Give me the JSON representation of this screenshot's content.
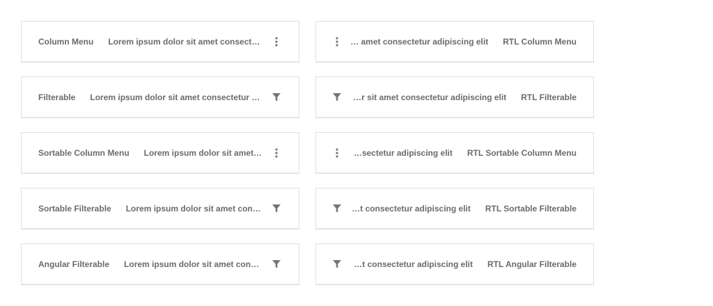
{
  "rows": [
    {
      "title": "Column Menu",
      "lorem_ltr": "Lorem ipsum dolor sit amet consectetur adipiscing elit",
      "rtl_title": "RTL Column Menu",
      "lorem_rtl": "…r sit amet consectetur adipiscing elit",
      "icon": "more-vert-icon"
    },
    {
      "title": "Filterable",
      "lorem_ltr": "Lorem ipsum dolor sit amet consectetur adipiscing elit",
      "rtl_title": "RTL Filterable",
      "lorem_rtl": "… dolor sit amet consectetur adipiscing elit",
      "icon": "filter-icon"
    },
    {
      "title": "Sortable Column Menu",
      "lorem_ltr": "Lorem ipsum dolor sit amet consectetur adipiscing elit",
      "rtl_title": "RTL Sortable Column Menu",
      "lorem_rtl": "…t consectetur adipiscing elit",
      "icon": "more-vert-icon"
    },
    {
      "title": "Sortable Filterable",
      "lorem_ltr": "Lorem ipsum dolor sit amet consectetur adipiscing elit",
      "rtl_title": "RTL Sortable Filterable",
      "lorem_rtl": "…t amet consectetur adipiscing elit",
      "icon": "filter-icon"
    },
    {
      "title": "Angular Filterable",
      "lorem_ltr": "Lorem ipsum dolor sit amet consectetur adipiscing elit",
      "rtl_title": "RTL Angular Filterable",
      "lorem_rtl": "…t amet consectetur adipiscing elit",
      "icon": "filter-icon"
    }
  ],
  "colors": {
    "text": "#6b6b6b",
    "icon": "#757575",
    "border": "#e0e0e0"
  }
}
